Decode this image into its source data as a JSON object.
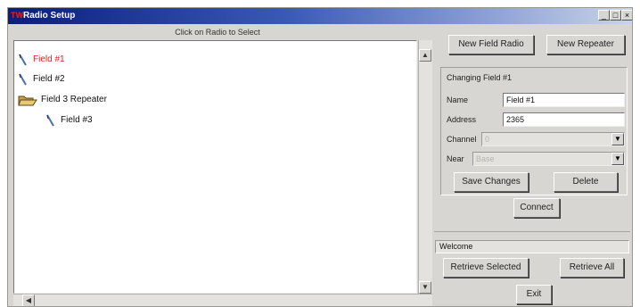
{
  "window": {
    "title": "Radio Setup",
    "app_icon": "TW",
    "controls": {
      "minimize": "_",
      "maximize": "□",
      "close": "×"
    }
  },
  "tree": {
    "hint": "Click on Radio to Select",
    "nodes": [
      {
        "label": "Field #1",
        "icon": "radio-icon",
        "selected": true,
        "color": "#e02020"
      },
      {
        "label": "Field #2",
        "icon": "radio-icon"
      },
      {
        "label": "Field 3 Repeater",
        "icon": "folder-open-icon"
      },
      {
        "label": "Field #3",
        "icon": "radio-icon"
      }
    ]
  },
  "actions": {
    "new_field_radio": "New Field Radio",
    "new_repeater": "New Repeater"
  },
  "edit": {
    "heading": "Changing Field #1",
    "name_label": "Name",
    "name_value": "Field #1",
    "address_label": "Address",
    "address_value": "2365",
    "channel_label": "Channel",
    "channel_value": "0",
    "near_label": "Near",
    "near_value": "Base",
    "save_label": "Save Changes",
    "delete_label": "Delete"
  },
  "connect_label": "Connect",
  "status_text": "Welcome",
  "retrieve_selected_label": "Retrieve Selected",
  "retrieve_all_label": "Retrieve All",
  "exit_label": "Exit"
}
